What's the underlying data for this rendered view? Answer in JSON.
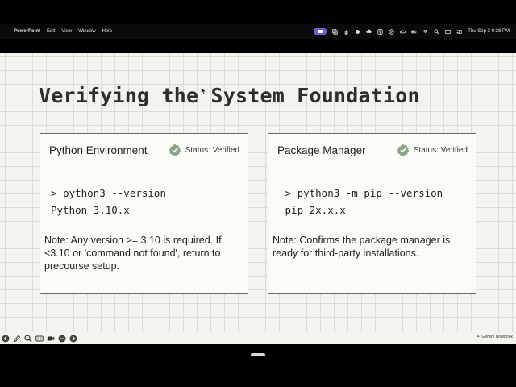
{
  "menubar": {
    "app_name": "PowerPoint",
    "menus": [
      "Edit",
      "View",
      "Window",
      "Help"
    ],
    "clock": "Thu Sep 3  9:28 PM"
  },
  "slide": {
    "title": "Verifying the System Foundation",
    "cards": [
      {
        "title": "Python Environment",
        "status": "Status: Verified",
        "code_line1": "> python3 --version",
        "code_line2": "Python 3.10.x",
        "note": "Note: Any version >= 3.10 is required. If <3.10 or    'command not found', return to precourse setup."
      },
      {
        "title": "Package Manager",
        "status": "Status: Verified",
        "code_line1": " > python3 -m pip --version",
        "code_line2": " pip 2x.x.x",
        "note": "Note: Confirms the package manager is ready for third-party installations."
      }
    ]
  },
  "toolbar": {
    "buttons": [
      "back-icon",
      "pen-icon",
      "zoom-icon",
      "captions-icon",
      "camera-icon",
      "more-icon",
      "forward-icon"
    ],
    "branding": "Gemini Notebook"
  },
  "colors": {
    "slide_bg": "#f4f3ee",
    "grid": "#dcdbd4",
    "check_green": "#8aa48a",
    "record_purple": "#6f5bd6"
  }
}
